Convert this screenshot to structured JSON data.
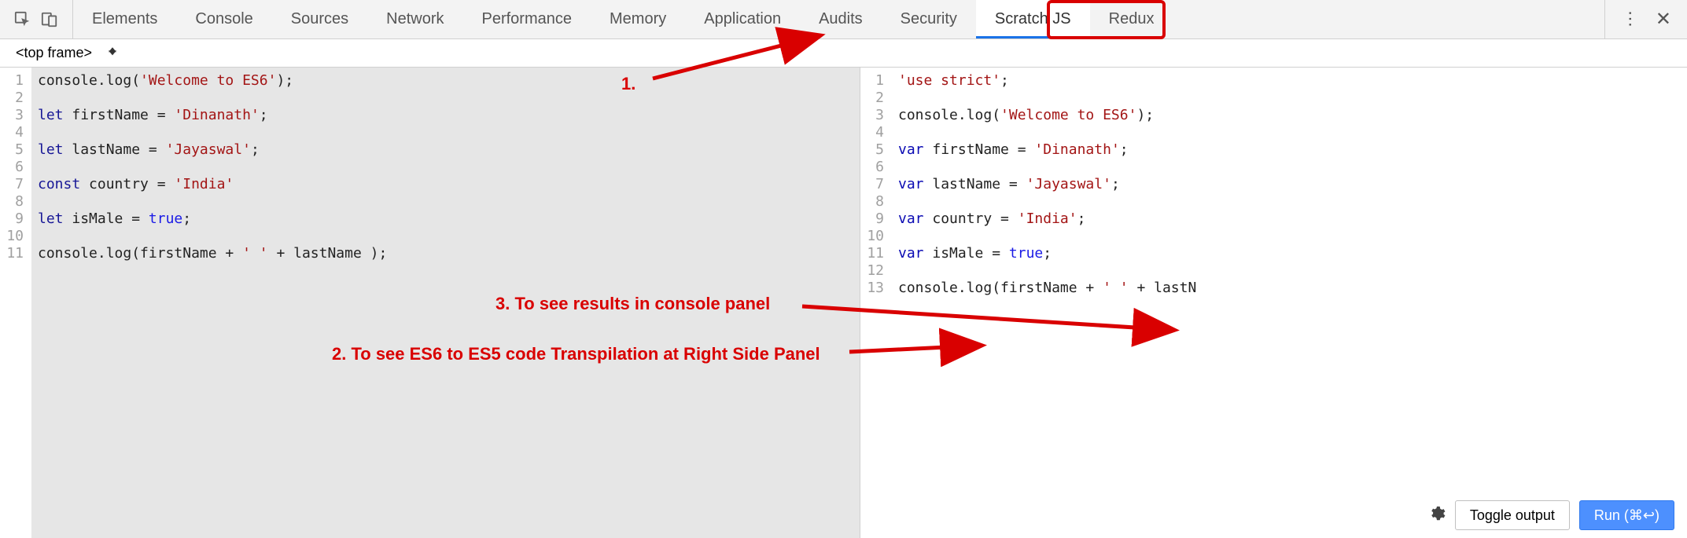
{
  "toolbar": {
    "tabs": [
      "Elements",
      "Console",
      "Sources",
      "Network",
      "Performance",
      "Memory",
      "Application",
      "Audits",
      "Security",
      "Scratch JS",
      "Redux"
    ],
    "active_tab_index": 9
  },
  "context_row": {
    "selected": "<top frame>"
  },
  "left_editor": {
    "line_numbers": [
      "1",
      "2",
      "3",
      "4",
      "5",
      "6",
      "7",
      "8",
      "9",
      "10",
      "11"
    ],
    "tokens": [
      [
        [
          "console.log(",
          "d"
        ],
        [
          "'Welcome to ES6'",
          "s"
        ],
        [
          ");",
          "d"
        ]
      ],
      [],
      [
        [
          "let ",
          "k"
        ],
        [
          "firstName = ",
          "d"
        ],
        [
          "'Dinanath'",
          "s"
        ],
        [
          ";",
          "d"
        ]
      ],
      [],
      [
        [
          "let ",
          "k"
        ],
        [
          "lastName = ",
          "d"
        ],
        [
          "'Jayaswal'",
          "s"
        ],
        [
          ";",
          "d"
        ]
      ],
      [],
      [
        [
          "const ",
          "k"
        ],
        [
          "country = ",
          "d"
        ],
        [
          "'India'",
          "s"
        ]
      ],
      [],
      [
        [
          "let ",
          "k"
        ],
        [
          "isMale = ",
          "d"
        ],
        [
          "true",
          "b"
        ],
        [
          ";",
          "d"
        ]
      ],
      [],
      [
        [
          "console.log(firstName + ",
          "d"
        ],
        [
          "' '",
          "s"
        ],
        [
          " + lastName );",
          "d"
        ]
      ]
    ]
  },
  "right_editor": {
    "line_numbers": [
      "1",
      "2",
      "3",
      "4",
      "5",
      "6",
      "7",
      "8",
      "9",
      "10",
      "11",
      "12",
      "13"
    ],
    "tokens": [
      [
        [
          "'use strict'",
          "s"
        ],
        [
          ";",
          "d"
        ]
      ],
      [],
      [
        [
          "console.log(",
          "d"
        ],
        [
          "'Welcome to ES6'",
          "s"
        ],
        [
          ");",
          "d"
        ]
      ],
      [],
      [
        [
          "var ",
          "k"
        ],
        [
          "firstName = ",
          "d"
        ],
        [
          "'Dinanath'",
          "s"
        ],
        [
          ";",
          "d"
        ]
      ],
      [],
      [
        [
          "var ",
          "k"
        ],
        [
          "lastName = ",
          "d"
        ],
        [
          "'Jayaswal'",
          "s"
        ],
        [
          ";",
          "d"
        ]
      ],
      [],
      [
        [
          "var ",
          "k"
        ],
        [
          "country = ",
          "d"
        ],
        [
          "'India'",
          "s"
        ],
        [
          ";",
          "d"
        ]
      ],
      [],
      [
        [
          "var ",
          "k"
        ],
        [
          "isMale = ",
          "d"
        ],
        [
          "true",
          "b"
        ],
        [
          ";",
          "d"
        ]
      ],
      [],
      [
        [
          "console.log(firstName + ",
          "d"
        ],
        [
          "' '",
          "s"
        ],
        [
          " + lastN",
          "d"
        ]
      ]
    ]
  },
  "bottom": {
    "toggle_label": "Toggle output",
    "run_label": "Run (⌘↩)"
  },
  "annotations": {
    "a1": "1.",
    "a2": "2. To see ES6 to ES5 code Transpilation at Right Side Panel",
    "a3": "3. To see results in console panel"
  }
}
